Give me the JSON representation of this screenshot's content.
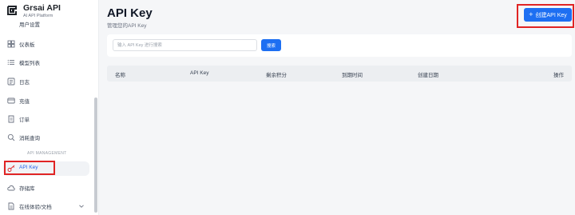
{
  "brand": {
    "name": "Grsai API",
    "subtitle": "AI API Platform"
  },
  "sidebar": {
    "partial_item": "用户设置",
    "items": [
      {
        "label": "仪表板",
        "icon": "dashboard-icon"
      },
      {
        "label": "模型列表",
        "icon": "list-icon"
      },
      {
        "label": "日志",
        "icon": "log-icon"
      },
      {
        "label": "充值",
        "icon": "card-icon"
      },
      {
        "label": "订单",
        "icon": "order-icon"
      },
      {
        "label": "消耗查询",
        "icon": "search-icon"
      }
    ],
    "section_label": "API MANAGEMENT",
    "management_items": [
      {
        "label": "API Key",
        "icon": "key-icon",
        "active": true
      },
      {
        "label": "存储库",
        "icon": "cloud-icon"
      },
      {
        "label": "在线体验/文档",
        "icon": "document-icon",
        "expandable": true
      }
    ]
  },
  "header": {
    "title": "API Key",
    "subtitle": "管理您的API Key",
    "create_label": "创建API Key"
  },
  "search": {
    "placeholder": "输入 API Key 进行搜索",
    "button_label": "搜索"
  },
  "table": {
    "columns": [
      "名称",
      "API Key",
      "剩余积分",
      "到期时间",
      "创建日期",
      "操作"
    ]
  },
  "colors": {
    "accent": "#1d6ff2",
    "highlight": "#e02424",
    "active_text": "#2563eb"
  }
}
